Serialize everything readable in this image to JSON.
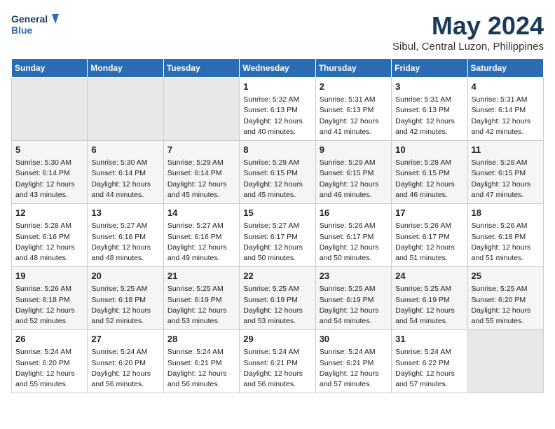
{
  "header": {
    "logo_line1": "General",
    "logo_line2": "Blue",
    "month_year": "May 2024",
    "location": "Sibul, Central Luzon, Philippines"
  },
  "weekdays": [
    "Sunday",
    "Monday",
    "Tuesday",
    "Wednesday",
    "Thursday",
    "Friday",
    "Saturday"
  ],
  "weeks": [
    [
      {
        "day": "",
        "detail": ""
      },
      {
        "day": "",
        "detail": ""
      },
      {
        "day": "",
        "detail": ""
      },
      {
        "day": "1",
        "detail": "Sunrise: 5:32 AM\nSunset: 6:13 PM\nDaylight: 12 hours\nand 40 minutes."
      },
      {
        "day": "2",
        "detail": "Sunrise: 5:31 AM\nSunset: 6:13 PM\nDaylight: 12 hours\nand 41 minutes."
      },
      {
        "day": "3",
        "detail": "Sunrise: 5:31 AM\nSunset: 6:13 PM\nDaylight: 12 hours\nand 42 minutes."
      },
      {
        "day": "4",
        "detail": "Sunrise: 5:31 AM\nSunset: 6:14 PM\nDaylight: 12 hours\nand 42 minutes."
      }
    ],
    [
      {
        "day": "5",
        "detail": "Sunrise: 5:30 AM\nSunset: 6:14 PM\nDaylight: 12 hours\nand 43 minutes."
      },
      {
        "day": "6",
        "detail": "Sunrise: 5:30 AM\nSunset: 6:14 PM\nDaylight: 12 hours\nand 44 minutes."
      },
      {
        "day": "7",
        "detail": "Sunrise: 5:29 AM\nSunset: 6:14 PM\nDaylight: 12 hours\nand 45 minutes."
      },
      {
        "day": "8",
        "detail": "Sunrise: 5:29 AM\nSunset: 6:15 PM\nDaylight: 12 hours\nand 45 minutes."
      },
      {
        "day": "9",
        "detail": "Sunrise: 5:29 AM\nSunset: 6:15 PM\nDaylight: 12 hours\nand 46 minutes."
      },
      {
        "day": "10",
        "detail": "Sunrise: 5:28 AM\nSunset: 6:15 PM\nDaylight: 12 hours\nand 46 minutes."
      },
      {
        "day": "11",
        "detail": "Sunrise: 5:28 AM\nSunset: 6:15 PM\nDaylight: 12 hours\nand 47 minutes."
      }
    ],
    [
      {
        "day": "12",
        "detail": "Sunrise: 5:28 AM\nSunset: 6:16 PM\nDaylight: 12 hours\nand 48 minutes."
      },
      {
        "day": "13",
        "detail": "Sunrise: 5:27 AM\nSunset: 6:16 PM\nDaylight: 12 hours\nand 48 minutes."
      },
      {
        "day": "14",
        "detail": "Sunrise: 5:27 AM\nSunset: 6:16 PM\nDaylight: 12 hours\nand 49 minutes."
      },
      {
        "day": "15",
        "detail": "Sunrise: 5:27 AM\nSunset: 6:17 PM\nDaylight: 12 hours\nand 50 minutes."
      },
      {
        "day": "16",
        "detail": "Sunrise: 5:26 AM\nSunset: 6:17 PM\nDaylight: 12 hours\nand 50 minutes."
      },
      {
        "day": "17",
        "detail": "Sunrise: 5:26 AM\nSunset: 6:17 PM\nDaylight: 12 hours\nand 51 minutes."
      },
      {
        "day": "18",
        "detail": "Sunrise: 5:26 AM\nSunset: 6:18 PM\nDaylight: 12 hours\nand 51 minutes."
      }
    ],
    [
      {
        "day": "19",
        "detail": "Sunrise: 5:26 AM\nSunset: 6:18 PM\nDaylight: 12 hours\nand 52 minutes."
      },
      {
        "day": "20",
        "detail": "Sunrise: 5:25 AM\nSunset: 6:18 PM\nDaylight: 12 hours\nand 52 minutes."
      },
      {
        "day": "21",
        "detail": "Sunrise: 5:25 AM\nSunset: 6:19 PM\nDaylight: 12 hours\nand 53 minutes."
      },
      {
        "day": "22",
        "detail": "Sunrise: 5:25 AM\nSunset: 6:19 PM\nDaylight: 12 hours\nand 53 minutes."
      },
      {
        "day": "23",
        "detail": "Sunrise: 5:25 AM\nSunset: 6:19 PM\nDaylight: 12 hours\nand 54 minutes."
      },
      {
        "day": "24",
        "detail": "Sunrise: 5:25 AM\nSunset: 6:19 PM\nDaylight: 12 hours\nand 54 minutes."
      },
      {
        "day": "25",
        "detail": "Sunrise: 5:25 AM\nSunset: 6:20 PM\nDaylight: 12 hours\nand 55 minutes."
      }
    ],
    [
      {
        "day": "26",
        "detail": "Sunrise: 5:24 AM\nSunset: 6:20 PM\nDaylight: 12 hours\nand 55 minutes."
      },
      {
        "day": "27",
        "detail": "Sunrise: 5:24 AM\nSunset: 6:20 PM\nDaylight: 12 hours\nand 56 minutes."
      },
      {
        "day": "28",
        "detail": "Sunrise: 5:24 AM\nSunset: 6:21 PM\nDaylight: 12 hours\nand 56 minutes."
      },
      {
        "day": "29",
        "detail": "Sunrise: 5:24 AM\nSunset: 6:21 PM\nDaylight: 12 hours\nand 56 minutes."
      },
      {
        "day": "30",
        "detail": "Sunrise: 5:24 AM\nSunset: 6:21 PM\nDaylight: 12 hours\nand 57 minutes."
      },
      {
        "day": "31",
        "detail": "Sunrise: 5:24 AM\nSunset: 6:22 PM\nDaylight: 12 hours\nand 57 minutes."
      },
      {
        "day": "",
        "detail": ""
      }
    ]
  ]
}
